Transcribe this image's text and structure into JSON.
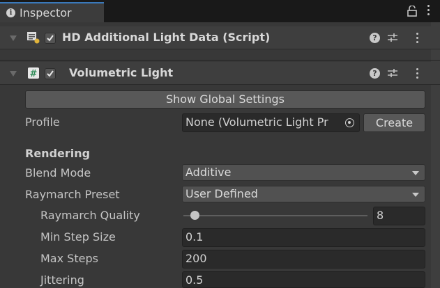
{
  "tab": {
    "title": "Inspector",
    "info_icon": "i"
  },
  "components": [
    {
      "title": "HD Additional Light Data (Script)",
      "enabled": true,
      "icon": "script-icon"
    },
    {
      "title": "Volumetric Light",
      "enabled": true,
      "icon": "hash-icon"
    }
  ],
  "volumetric": {
    "show_global_settings": "Show Global Settings",
    "profile_label": "Profile",
    "profile_value": "None (Volumetric Light Pr",
    "create_button": "Create",
    "rendering_header": "Rendering",
    "blend_mode_label": "Blend Mode",
    "blend_mode_value": "Additive",
    "raymarch_preset_label": "Raymarch Preset",
    "raymarch_preset_value": "User Defined",
    "raymarch_quality_label": "Raymarch Quality",
    "raymarch_quality_value": "8",
    "raymarch_quality_fraction": 0.06,
    "min_step_size_label": "Min Step Size",
    "min_step_size_value": "0.1",
    "max_steps_label": "Max Steps",
    "max_steps_value": "200",
    "jittering_label": "Jittering",
    "jittering_value": "0.5"
  },
  "colors": {
    "accent_tab": "#3a79bb",
    "panel_bg": "#383838",
    "field_bg": "#2a2a2a"
  }
}
